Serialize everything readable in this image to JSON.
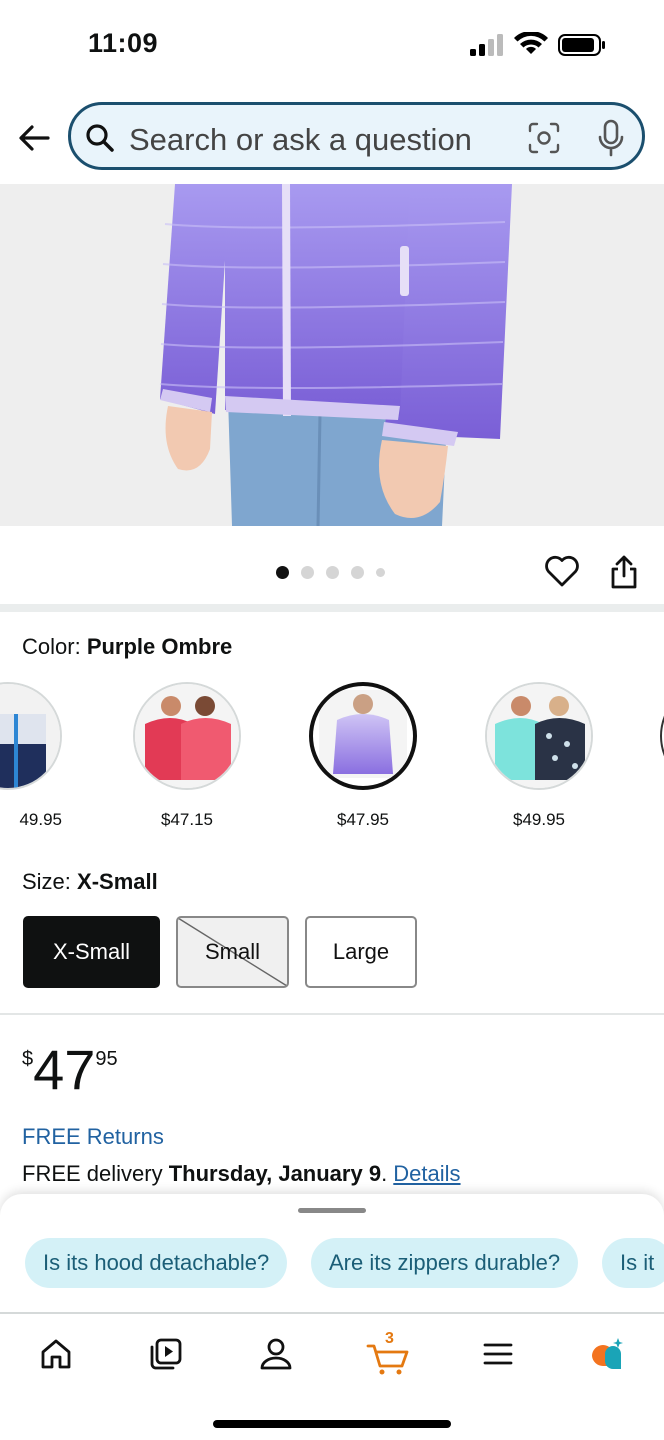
{
  "status_bar": {
    "time": "11:09"
  },
  "search": {
    "placeholder": "Search or ask a question"
  },
  "image_carousel": {
    "total": 5,
    "active_index": 0
  },
  "color": {
    "label": "Color:",
    "selected": "Purple Ombre",
    "swatches": [
      {
        "price": "$49.95",
        "colors": [
          "#dfe4ee",
          "#1f2f5c"
        ]
      },
      {
        "price": "$47.15",
        "colors": [
          "#e23a55",
          "#f05a70"
        ]
      },
      {
        "price": "$47.95",
        "colors": [
          "#b7a4ef",
          "#8a6fe0"
        ]
      },
      {
        "price": "$49.95",
        "colors": [
          "#7de3dc",
          "#2a3346"
        ]
      }
    ],
    "visible_partial_price": "49.95"
  },
  "size": {
    "label": "Size:",
    "selected": "X-Small",
    "options": [
      "X-Small",
      "Small",
      "Large"
    ]
  },
  "price": {
    "symbol": "$",
    "whole": "47",
    "fraction": "95"
  },
  "free_returns": "FREE Returns",
  "delivery": {
    "prefix": "FREE delivery ",
    "date": "Thursday, January 9",
    "suffix": ". ",
    "link": "Details"
  },
  "questions": [
    "Is its hood detachable?",
    "Are its zippers durable?",
    "Is it"
  ],
  "bottom_nav": {
    "cart_count": "3",
    "accent": "#e47911"
  }
}
